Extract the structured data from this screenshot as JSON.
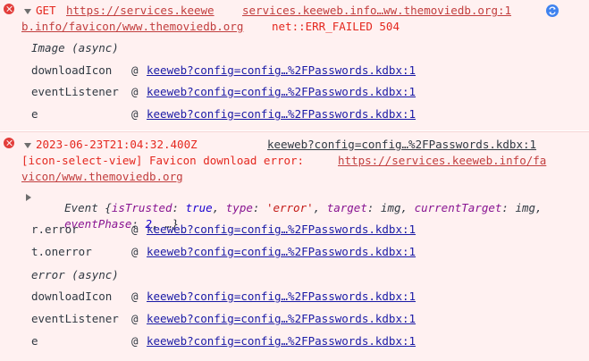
{
  "msg1": {
    "method": "GET",
    "url_start": "https://services.keewe",
    "source": "services.keeweb.info…ww.themoviedb.org:1",
    "url_cont": "b.info/favicon/www.themoviedb.org",
    "error": "net::ERR_FAILED 504",
    "async_label": "Image (async)",
    "stack": [
      {
        "fn": "downloadIcon",
        "at": "@",
        "loc": "keeweb?config=config…%2FPasswords.kdbx:1"
      },
      {
        "fn": "eventListener",
        "at": "@",
        "loc": "keeweb?config=config…%2FPasswords.kdbx:1"
      },
      {
        "fn": "e",
        "at": "@",
        "loc": "keeweb?config=config…%2FPasswords.kdbx:1"
      }
    ]
  },
  "msg2": {
    "timestamp": "2023-06-23T21:04:32.400Z",
    "source": "keeweb?config=config…%2FPasswords.kdbx:1",
    "text1": "[icon-select-view] Favicon download error: ",
    "url1": "https://services.keeweb.info/fa",
    "url2": "vicon/www.themoviedb.org",
    "event": {
      "name": "Event",
      "open": "{",
      "k1": "isTrusted",
      "v1": "true",
      "k2": "type",
      "v2": "'error'",
      "k3": "target",
      "v3": "img",
      "k4": "currentTarget",
      "v4": "img",
      "k5": "eventPhase",
      "v5": "2",
      "tail": "…}"
    },
    "stack_sync": [
      {
        "fn": "r.error",
        "at": "@",
        "loc": "keeweb?config=config…%2FPasswords.kdbx:1"
      },
      {
        "fn": "t.onerror",
        "at": "@",
        "loc": "keeweb?config=config…%2FPasswords.kdbx:1"
      }
    ],
    "async_label": "error (async)",
    "stack": [
      {
        "fn": "downloadIcon",
        "at": "@",
        "loc": "keeweb?config=config…%2FPasswords.kdbx:1"
      },
      {
        "fn": "eventListener",
        "at": "@",
        "loc": "keeweb?config=config…%2FPasswords.kdbx:1"
      },
      {
        "fn": "e",
        "at": "@",
        "loc": "keeweb?config=config…%2FPasswords.kdbx:1"
      }
    ]
  },
  "colors": {
    "error_bg": "#fff1f1",
    "error_text": "#e4281f",
    "link": "#1a1aa6"
  }
}
